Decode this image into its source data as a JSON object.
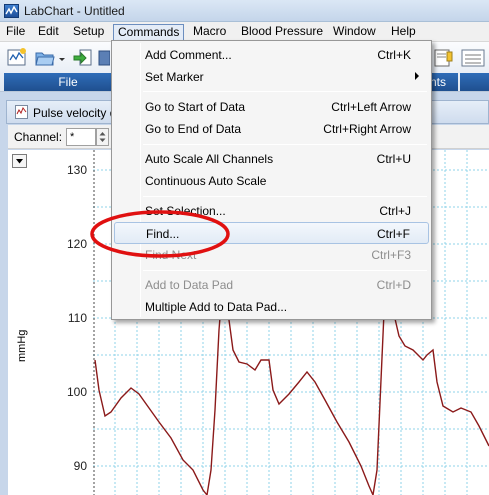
{
  "window": {
    "title": "LabChart - Untitled"
  },
  "menubar": {
    "items": [
      {
        "label": "File"
      },
      {
        "label": "Edit"
      },
      {
        "label": "Setup"
      },
      {
        "label": "Commands"
      },
      {
        "label": "Macro"
      },
      {
        "label": "Blood Pressure"
      },
      {
        "label": "Window"
      },
      {
        "label": "Help"
      }
    ]
  },
  "toolbar": {
    "group_file_label": "File",
    "group_right_label": "nts"
  },
  "document": {
    "title": "Pulse velocity d",
    "channel_label": "Channel:",
    "channel_value": "*"
  },
  "axis": {
    "unit": "mmHg",
    "ticks": [
      "130",
      "120",
      "110",
      "100",
      "90"
    ]
  },
  "commands_menu": {
    "items": [
      {
        "label": "Add Comment...",
        "shortcut": "Ctrl+K",
        "enabled": true
      },
      {
        "label": "Set Marker",
        "shortcut": "",
        "enabled": true,
        "submenu": true
      },
      {
        "label": "Go to Start of Data",
        "shortcut": "Ctrl+Left Arrow",
        "enabled": true
      },
      {
        "label": "Go to End of Data",
        "shortcut": "Ctrl+Right Arrow",
        "enabled": true
      },
      {
        "label": "Auto Scale All Channels",
        "shortcut": "Ctrl+U",
        "enabled": true
      },
      {
        "label": "Continuous Auto Scale",
        "shortcut": "",
        "enabled": true
      },
      {
        "label": "Set Selection...",
        "shortcut": "Ctrl+J",
        "enabled": true
      },
      {
        "label": "Find...",
        "shortcut": "Ctrl+F",
        "enabled": true,
        "highlighted": true
      },
      {
        "label": "Find Next",
        "shortcut": "Ctrl+F3",
        "enabled": false
      },
      {
        "label": "Add to Data Pad",
        "shortcut": "Ctrl+D",
        "enabled": false
      },
      {
        "label": "Multiple Add to Data Pad...",
        "shortcut": "",
        "enabled": true
      }
    ]
  },
  "colors": {
    "trace": "#8b1a1a",
    "grid": "#8fd3e8",
    "annotation": "#e01010",
    "toolbar_group": "#1f4f8f"
  }
}
